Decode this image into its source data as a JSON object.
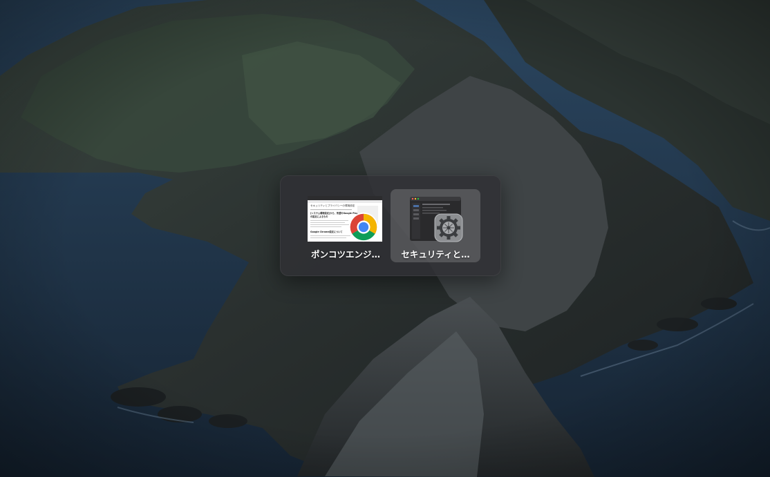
{
  "app_switcher": {
    "apps": [
      {
        "name": "ポンコツエンジ…",
        "icon": "chrome-icon",
        "selected": false,
        "preview": {
          "header_text": "セキュリティとプライバシーの環境設定",
          "line1": "[システム環境設定]から、所望のGoogle Play",
          "line2": "の設定によるもの",
          "line3": "Google Chrome設定について"
        }
      },
      {
        "name": "セキュリティと…",
        "icon": "gear-icon",
        "selected": true
      }
    ]
  },
  "colors": {
    "switcher_bg": "#303034",
    "selected_bg": "#5a5a60",
    "label": "#ffffff",
    "chrome_red": "#db4437",
    "chrome_yellow": "#f4b400",
    "chrome_green": "#0f9d58",
    "chrome_blue": "#4285f4"
  }
}
